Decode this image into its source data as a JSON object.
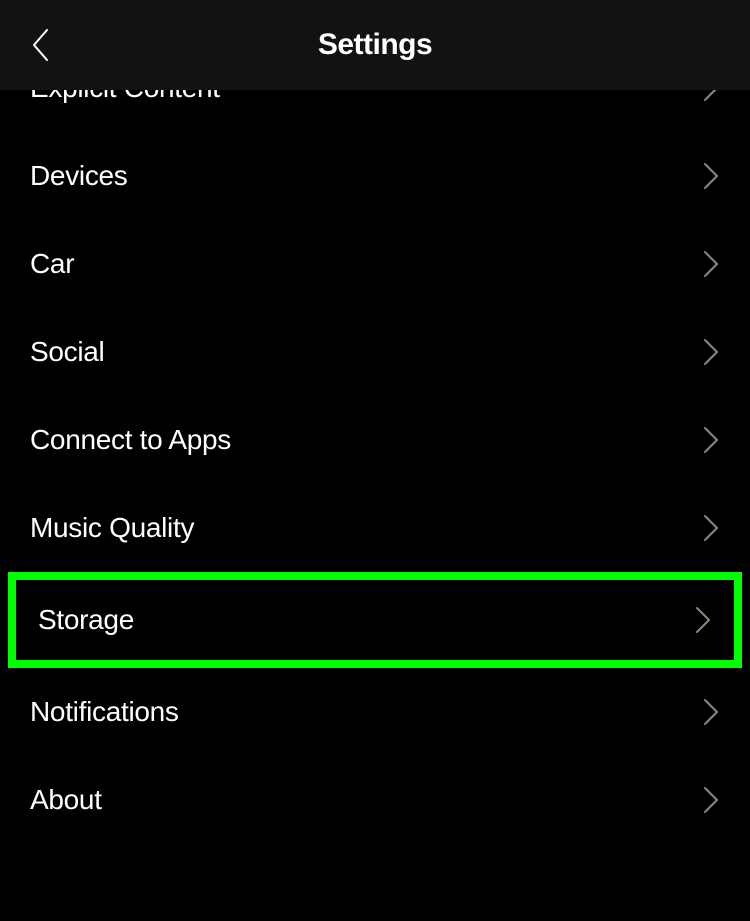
{
  "header": {
    "title": "Settings"
  },
  "settings": {
    "items": [
      {
        "label": "Explicit Content",
        "highlighted": false,
        "cutoff": true
      },
      {
        "label": "Devices",
        "highlighted": false,
        "cutoff": false
      },
      {
        "label": "Car",
        "highlighted": false,
        "cutoff": false
      },
      {
        "label": "Social",
        "highlighted": false,
        "cutoff": false
      },
      {
        "label": "Connect to Apps",
        "highlighted": false,
        "cutoff": false
      },
      {
        "label": "Music Quality",
        "highlighted": false,
        "cutoff": false
      },
      {
        "label": "Storage",
        "highlighted": true,
        "cutoff": false
      },
      {
        "label": "Notifications",
        "highlighted": false,
        "cutoff": false
      },
      {
        "label": "About",
        "highlighted": false,
        "cutoff": false
      }
    ]
  }
}
